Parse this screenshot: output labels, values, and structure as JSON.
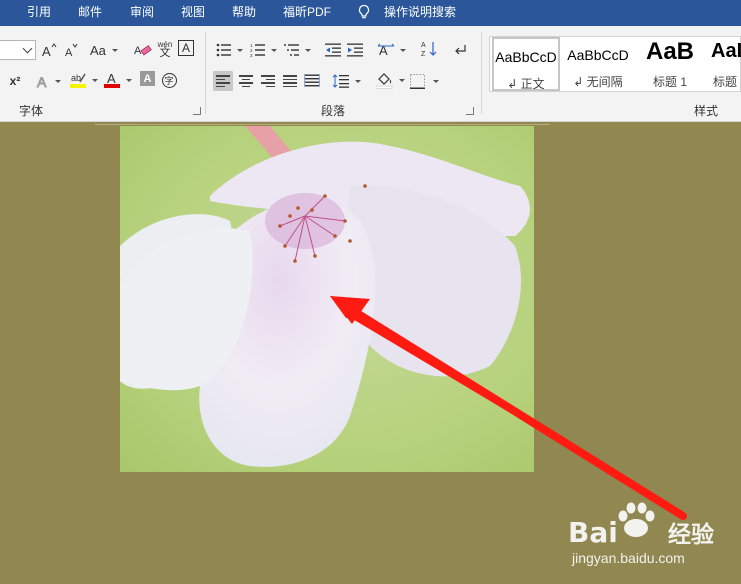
{
  "menubar": {
    "items": [
      "引用",
      "邮件",
      "审阅",
      "视图",
      "帮助",
      "福昕PDF"
    ],
    "tell_me": "操作说明搜索"
  },
  "ribbon": {
    "font_group": {
      "label": "字体",
      "font_size_value": "",
      "change_case_label": "Aa",
      "superscript_label": "x²",
      "phonetic_label": "wén",
      "enclose_label": "字"
    },
    "paragraph_group": {
      "label": "段落"
    },
    "styles_group": {
      "label": "样式",
      "items": [
        {
          "preview": "AaBbCcD",
          "name": "↲ 正文"
        },
        {
          "preview": "AaBbCcD",
          "name": "↲ 无间隔"
        },
        {
          "preview": "AaB",
          "name": "标题 1"
        },
        {
          "preview": "AaI",
          "name": "标题"
        }
      ]
    }
  },
  "watermark": {
    "logo": "Bai",
    "logo_suffix": "du",
    "cn": "经验",
    "url": "jingyan.baidu.com"
  },
  "colors": {
    "titlebar": "#2b579a",
    "document_bg": "#918751",
    "arrow": "#ff1a12"
  }
}
